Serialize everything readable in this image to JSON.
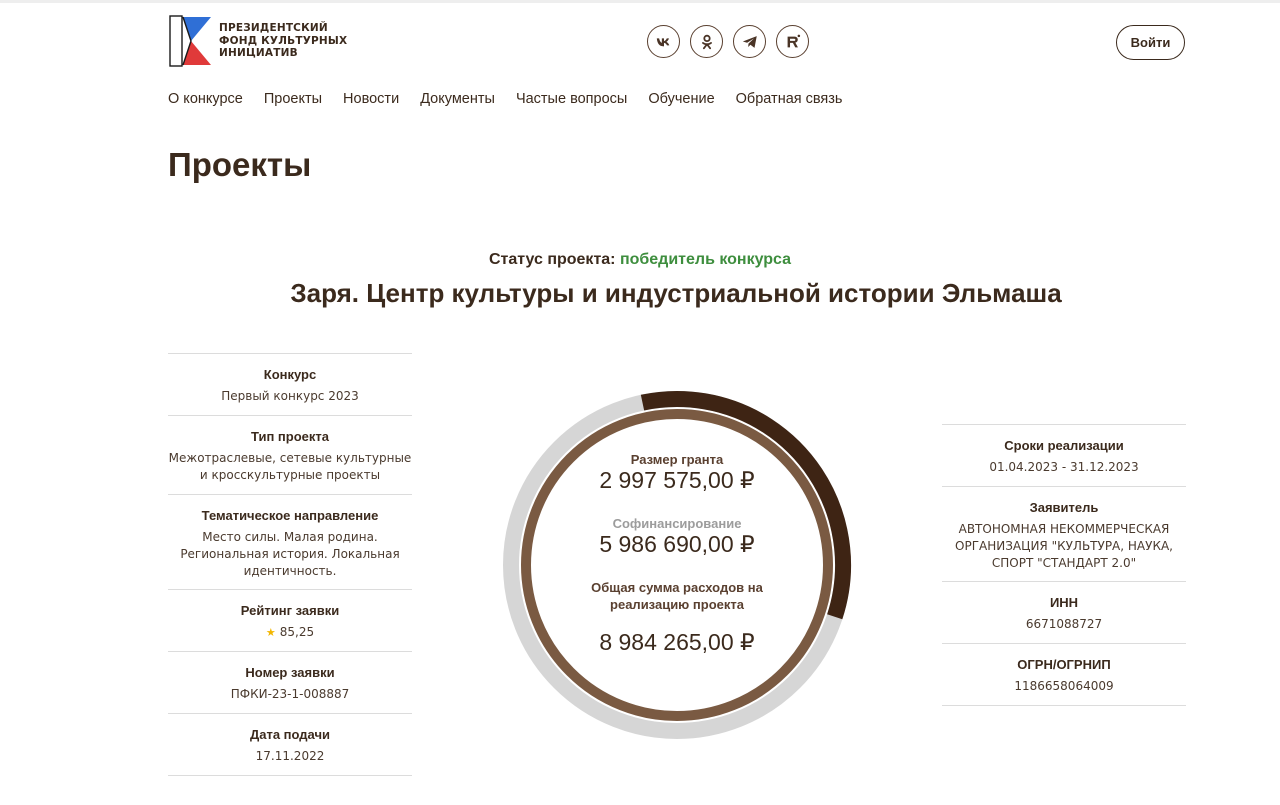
{
  "header": {
    "logo_lines": [
      "ПРЕЗИДЕНТСКИЙ",
      "ФОНД КУЛЬТУРНЫХ",
      "ИНИЦИАТИВ"
    ],
    "socials": [
      "vk-icon",
      "odnoklassniki-icon",
      "telegram-icon",
      "rutube-icon"
    ],
    "login_label": "Войти"
  },
  "nav": [
    "О конкурсе",
    "Проекты",
    "Новости",
    "Документы",
    "Частые вопросы",
    "Обучение",
    "Обратная связь"
  ],
  "page_title": "Проекты",
  "status": {
    "label": "Статус проекта:",
    "value": "победитель конкурса"
  },
  "project_title": "Заря. Центр культуры и индустриальной истории Эльмаша",
  "left_info": [
    {
      "label": "Конкурс",
      "value": "Первый конкурс 2023"
    },
    {
      "label": "Тип проекта",
      "value": "Межотраслевые, сетевые культурные и кросскультурные проекты"
    },
    {
      "label": "Тематическое направление",
      "value": "Место силы. Малая родина. Региональная история. Локальная идентичность."
    },
    {
      "label": "Рейтинг заявки",
      "value": "85,25"
    },
    {
      "label": "Номер заявки",
      "value": "ПФКИ-23-1-008887"
    },
    {
      "label": "Дата подачи",
      "value": "17.11.2022"
    }
  ],
  "right_info": [
    {
      "label": "Сроки реализации",
      "value": "01.04.2023 - 31.12.2023"
    },
    {
      "label": "Заявитель",
      "value": "АВТОНОМНАЯ НЕКОММЕРЧЕСКАЯ ОРГАНИЗАЦИЯ \"КУЛЬТУРА, НАУКА, СПОРТ \"СТАНДАРТ 2.0\""
    },
    {
      "label": "ИНН",
      "value": "6671088727"
    },
    {
      "label": "ОГРН/ОГРНИП",
      "value": "1186658064009"
    }
  ],
  "finance": {
    "grant_label": "Размер гранта",
    "grant_value": "2 997 575,00 ₽",
    "cofin_label": "Софинансирование",
    "cofin_value": "5 986 690,00 ₽",
    "total_label": "Общая сумма расходов на реализацию проекта",
    "total_value": "8 984 265,00 ₽",
    "grant_share": 0.3337
  },
  "colors": {
    "text": "#3b2a1d",
    "winner": "#3e8e3e",
    "ring_track": "#d6d6d6",
    "ring_grant": "#3e2414",
    "ring_inner": "#7a5a42",
    "star": "#f2b600"
  }
}
